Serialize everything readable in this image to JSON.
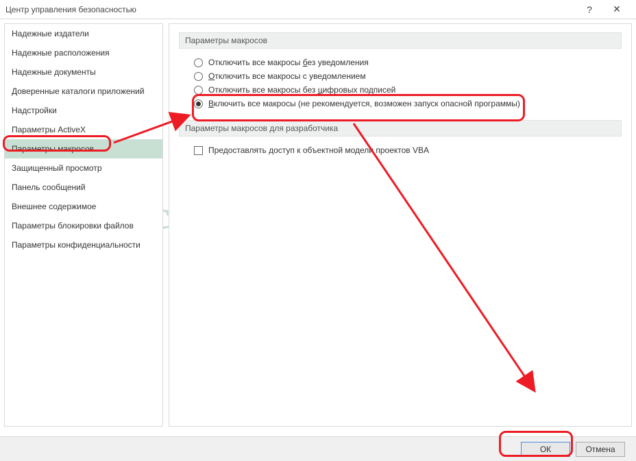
{
  "window": {
    "title": "Центр управления безопасностью",
    "help": "?",
    "close": "✕"
  },
  "sidebar": {
    "items": [
      {
        "label": "Надежные издатели"
      },
      {
        "label": "Надежные расположения"
      },
      {
        "label": "Надежные документы"
      },
      {
        "label": "Доверенные каталоги приложений"
      },
      {
        "label": "Надстройки"
      },
      {
        "label": "Параметры ActiveX"
      },
      {
        "label": "Параметры макросов",
        "selected": true
      },
      {
        "label": "Защищенный просмотр"
      },
      {
        "label": "Панель сообщений"
      },
      {
        "label": "Внешнее содержимое"
      },
      {
        "label": "Параметры блокировки файлов"
      },
      {
        "label": "Параметры конфиденциальности"
      }
    ]
  },
  "content": {
    "group1": {
      "title": "Параметры макросов",
      "options": [
        {
          "pre": "Отключить все макросы ",
          "acc": "б",
          "post": "ез уведомления",
          "checked": false
        },
        {
          "pre": "",
          "acc": "О",
          "post": "тключить все макросы с уведомлением",
          "checked": false
        },
        {
          "pre": "Отключить все макросы без ",
          "acc": "ц",
          "post": "ифровых подписей",
          "checked": false
        },
        {
          "pre": "",
          "acc": "В",
          "post": "ключить все макросы (не рекомендуется, возможен запуск опасной программы)",
          "checked": true
        }
      ]
    },
    "group2": {
      "title": "Параметры макросов для разработчика",
      "checkbox": {
        "label": "Предоставлять доступ к объектной модели проектов VBA",
        "checked": false
      }
    }
  },
  "footer": {
    "ok": "ОК",
    "cancel": "Отмена"
  },
  "watermark": "RuExcel.ru"
}
